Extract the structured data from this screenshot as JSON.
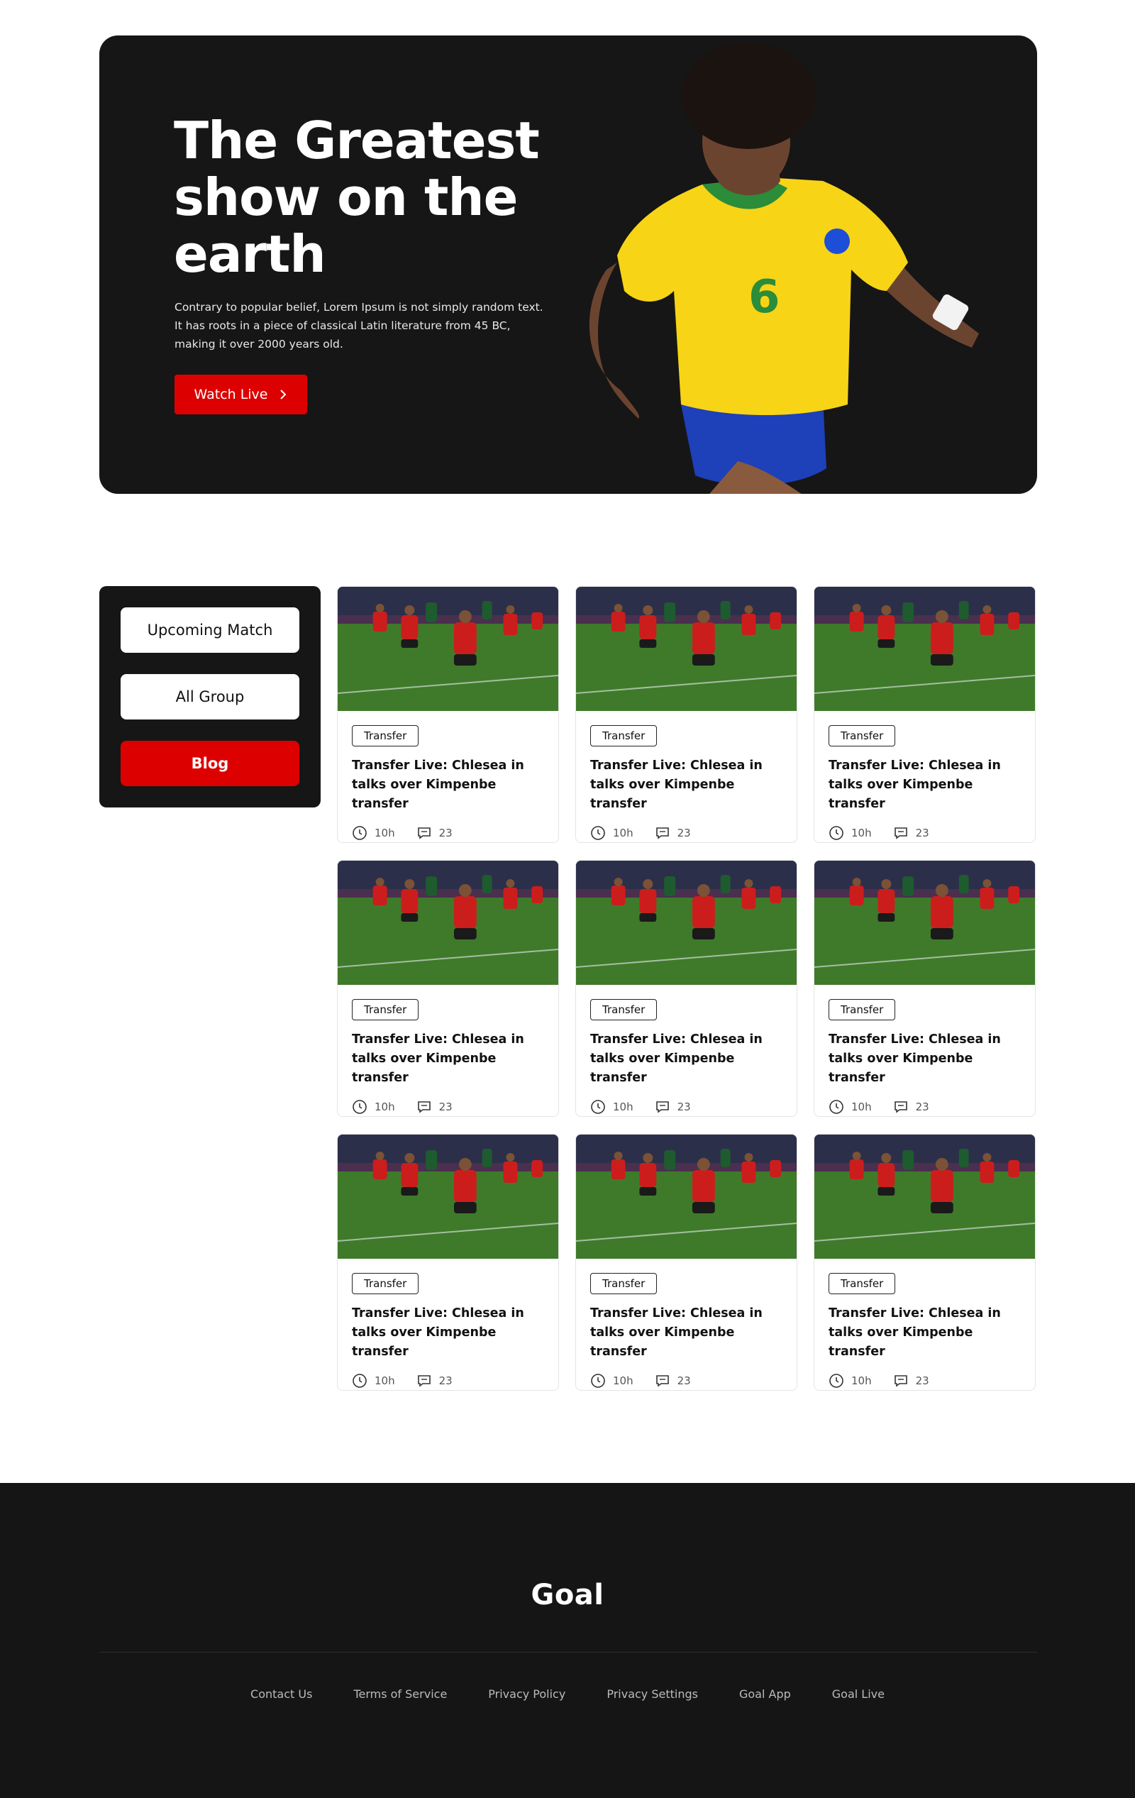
{
  "hero": {
    "title": "The Greatest show on the earth",
    "description": "Contrary to popular belief, Lorem Ipsum is not simply random text. It has roots in a piece of classical Latin literature from 45 BC, making it over 2000 years old.",
    "watch_label": "Watch Live",
    "player_number": "6"
  },
  "sidebar": {
    "items": [
      {
        "label": "Upcoming Match"
      },
      {
        "label": "All Group"
      },
      {
        "label": "Blog"
      }
    ]
  },
  "cards": [
    {
      "tag": "Transfer",
      "title": "Transfer Live: Chlesea in talks over Kimpenbe transfer",
      "time": "10h",
      "comments": "23"
    },
    {
      "tag": "Transfer",
      "title": "Transfer Live: Chlesea in talks over Kimpenbe transfer",
      "time": "10h",
      "comments": "23"
    },
    {
      "tag": "Transfer",
      "title": "Transfer Live: Chlesea in talks over Kimpenbe transfer",
      "time": "10h",
      "comments": "23"
    },
    {
      "tag": "Transfer",
      "title": "Transfer Live: Chlesea in talks over Kimpenbe transfer",
      "time": "10h",
      "comments": "23"
    },
    {
      "tag": "Transfer",
      "title": "Transfer Live: Chlesea in talks over Kimpenbe transfer",
      "time": "10h",
      "comments": "23"
    },
    {
      "tag": "Transfer",
      "title": "Transfer Live: Chlesea in talks over Kimpenbe transfer",
      "time": "10h",
      "comments": "23"
    },
    {
      "tag": "Transfer",
      "title": "Transfer Live: Chlesea in talks over Kimpenbe transfer",
      "time": "10h",
      "comments": "23"
    },
    {
      "tag": "Transfer",
      "title": "Transfer Live: Chlesea in talks over Kimpenbe transfer",
      "time": "10h",
      "comments": "23"
    },
    {
      "tag": "Transfer",
      "title": "Transfer Live: Chlesea in talks over Kimpenbe transfer",
      "time": "10h",
      "comments": "23"
    }
  ],
  "footer": {
    "logo": "Goal",
    "links": [
      "Contact Us",
      "Terms of Service",
      "Privacy Policy",
      "Privacy Settings",
      "Goal App",
      "Goal Live"
    ]
  },
  "colors": {
    "accent": "#dd0000",
    "dark": "#161616",
    "footer_bg": "#151515"
  },
  "icons": {
    "watch_arrow": "chevron-right-icon",
    "time": "clock-icon",
    "comments": "comment-icon"
  }
}
